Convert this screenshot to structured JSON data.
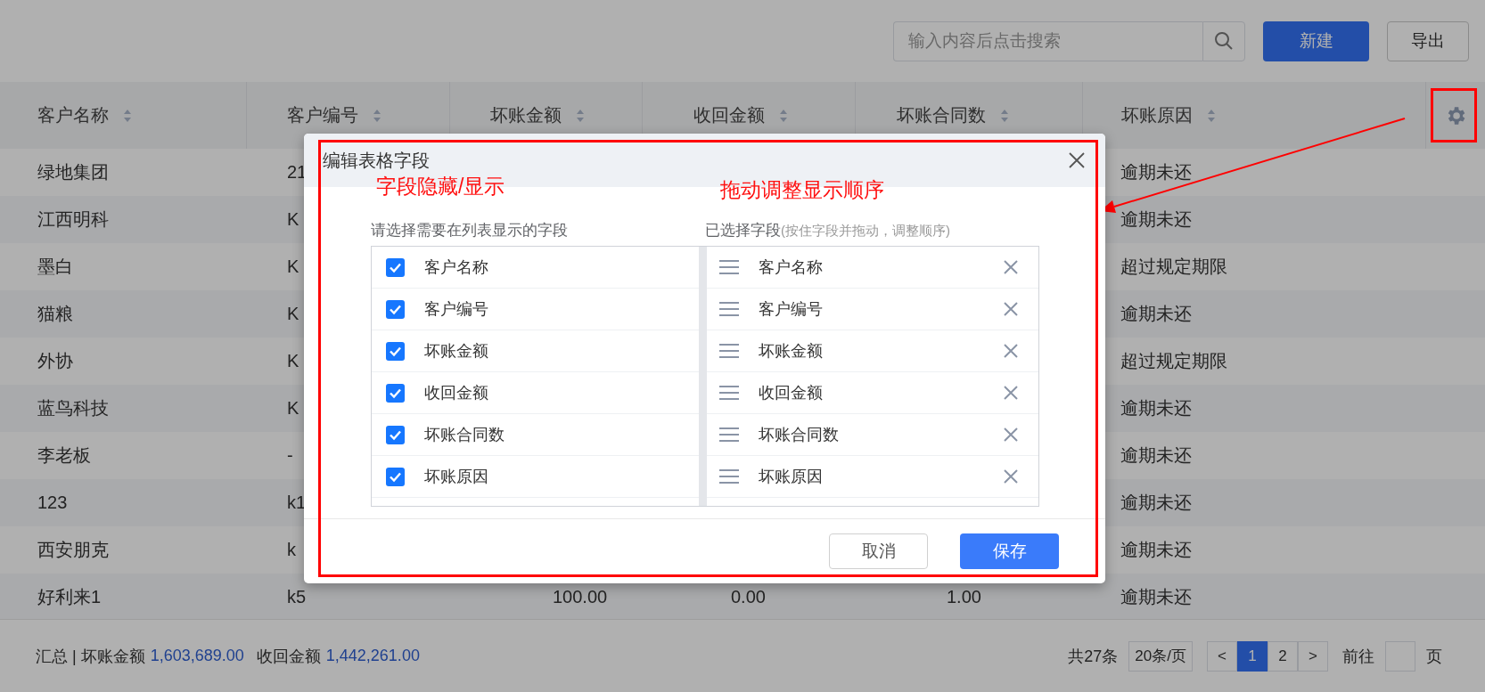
{
  "toolbar": {
    "search": {
      "placeholder": "输入内容后点击搜索"
    },
    "buttons": [
      {
        "label": "新建",
        "kind": "primary"
      },
      {
        "label": "导出",
        "kind": "default"
      }
    ]
  },
  "table": {
    "columns": [
      {
        "label": "客户名称",
        "sortable": true
      },
      {
        "label": "客户编号",
        "sortable": true
      },
      {
        "label": "坏账金额",
        "sortable": true
      },
      {
        "label": "收回金额",
        "sortable": true
      },
      {
        "label": "坏账合同数",
        "sortable": true
      },
      {
        "label": "坏账原因",
        "sortable": true
      }
    ],
    "rows": [
      {
        "customer_name": "绿地集团",
        "customer_code": "21",
        "reason": "逾期未还"
      },
      {
        "customer_name": "江西明科",
        "customer_code": "K",
        "reason": "逾期未还"
      },
      {
        "customer_name": "墨白",
        "customer_code": "K",
        "reason": "超过规定期限"
      },
      {
        "customer_name": "猫粮",
        "customer_code": "K",
        "reason": "逾期未还"
      },
      {
        "customer_name": "外协",
        "customer_code": "K",
        "reason": "超过规定期限"
      },
      {
        "customer_name": "蓝鸟科技",
        "customer_code": "K",
        "reason": "逾期未还"
      },
      {
        "customer_name": "李老板",
        "customer_code": "-",
        "reason": "逾期未还"
      },
      {
        "customer_name": "123",
        "customer_code": "k1",
        "reason": "逾期未还"
      },
      {
        "customer_name": "西安朋克",
        "customer_code": "k",
        "reason": "逾期未还"
      },
      {
        "customer_name": "好利来1",
        "customer_code": "k5",
        "bad_debt_amount": "100.00",
        "recovered_amount": "0.00",
        "contract_count": "1.00",
        "reason": "逾期未还"
      }
    ]
  },
  "summary": {
    "label": "汇总 | 坏账金额",
    "bad_debt_total": "1,603,689.00",
    "recovered_label": "收回金额",
    "recovered_total": "1,442,261.00"
  },
  "pagination": {
    "total": "共27条",
    "page_size": "20条/页",
    "prev": "<",
    "pages": [
      {
        "label": "1",
        "selected": true
      },
      {
        "label": "2",
        "selected": false
      }
    ],
    "next": ">",
    "goto_label": "前往",
    "goto_suffix": "页"
  },
  "modal": {
    "title": "编辑表格字段",
    "left_heading": "请选择需要在列表显示的字段",
    "right_heading": "已选择字段",
    "right_hint": "(按住字段并拖动，调整顺序)",
    "available_fields": [
      {
        "label": "客户名称",
        "checked": true
      },
      {
        "label": "客户编号",
        "checked": true
      },
      {
        "label": "坏账金额",
        "checked": true
      },
      {
        "label": "收回金额",
        "checked": true
      },
      {
        "label": "坏账合同数",
        "checked": true
      },
      {
        "label": "坏账原因",
        "checked": true
      }
    ],
    "selected_fields": [
      {
        "label": "客户名称"
      },
      {
        "label": "客户编号"
      },
      {
        "label": "坏账金额"
      },
      {
        "label": "收回金额"
      },
      {
        "label": "坏账合同数"
      },
      {
        "label": "坏账原因"
      }
    ],
    "buttons": [
      {
        "label": "取消",
        "kind": "default"
      },
      {
        "label": "保存",
        "kind": "primary"
      }
    ]
  },
  "annotations": [
    {
      "text": "字段隐藏/显示",
      "kind": "left"
    },
    {
      "text": "拖动调整显示顺序",
      "kind": "right"
    }
  ]
}
